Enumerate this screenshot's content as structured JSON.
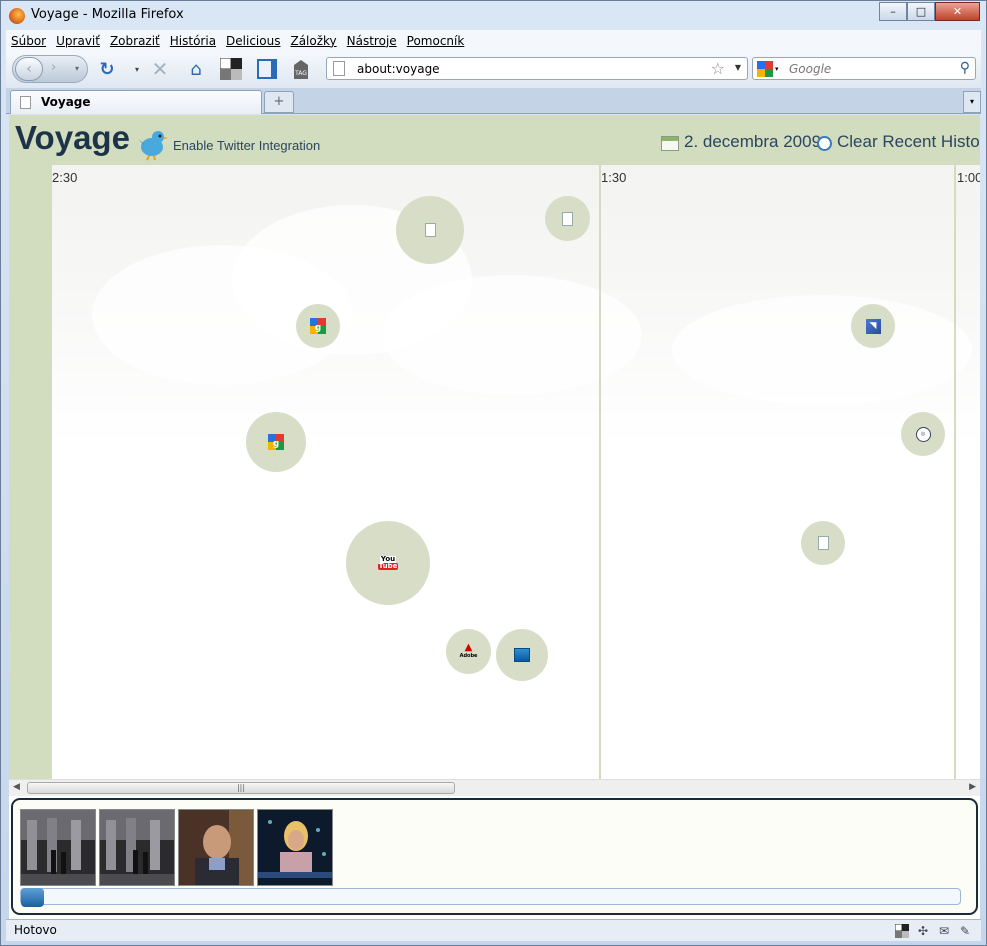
{
  "window": {
    "title": "Voyage - Mozilla Firefox",
    "minimize": "–",
    "maximize": "□",
    "close": "✕"
  },
  "menubar": {
    "items": [
      "Súbor",
      "Upraviť",
      "Zobraziť",
      "História",
      "Delicious",
      "Záložky",
      "Nástroje",
      "Pomocník"
    ]
  },
  "navbar": {
    "url": "about:voyage",
    "search_placeholder": "Google",
    "icons": [
      "back-icon",
      "forward-icon",
      "reload-icon",
      "stop-icon",
      "home-icon",
      "delicious-icon",
      "bookmark-sidebar-icon",
      "tag-icon"
    ]
  },
  "tabs": [
    {
      "label": "Voyage",
      "active": true
    }
  ],
  "voyage": {
    "logo": "Voyage",
    "twitter_link": "Enable Twitter Integration",
    "date": "2. decembra 2009",
    "clear_history": "Clear Recent History",
    "header_color": "#d2dcbe",
    "bubble_color": "#d7ddc6",
    "time_labels": [
      "2:30",
      "1:30",
      "1:00"
    ],
    "history_sites": [
      {
        "icon": "page-icon"
      },
      {
        "icon": "page-icon"
      },
      {
        "icon": "google-icon"
      },
      {
        "icon": "google-icon"
      },
      {
        "icon": "youtube-icon",
        "you": "You",
        "tube": "Tube"
      },
      {
        "icon": "adobe-icon",
        "text": "Adobe"
      },
      {
        "icon": "chart-icon"
      },
      {
        "icon": "rss-icon"
      },
      {
        "icon": "globe-icon"
      },
      {
        "icon": "page-icon"
      }
    ]
  },
  "video_panel": {
    "thumbnails": [
      "video-thumbnail",
      "video-thumbnail",
      "video-thumbnail",
      "video-thumbnail"
    ]
  },
  "status": {
    "text": "Hotovo"
  }
}
